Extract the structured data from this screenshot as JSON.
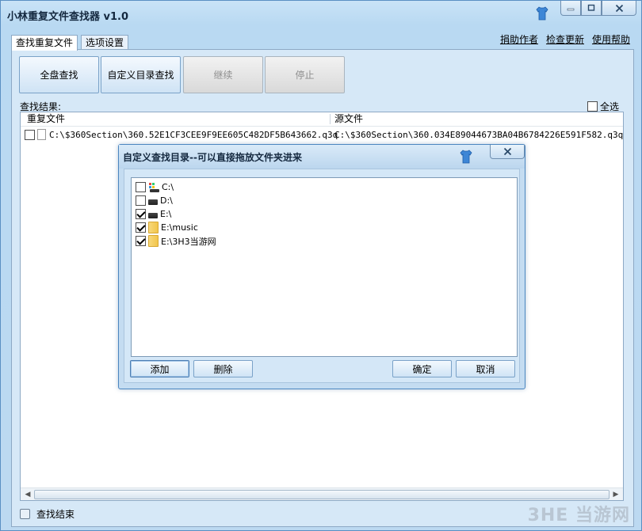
{
  "window": {
    "title": "小林重复文件查找器 v1.0"
  },
  "tabs": [
    {
      "label": "查找重复文件",
      "active": true
    },
    {
      "label": "选项设置",
      "active": false
    }
  ],
  "top_links": [
    "捐助作者",
    "检查更新",
    "使用帮助"
  ],
  "toolbar": {
    "full_scan": "全盘查找",
    "custom_scan": "自定义目录查找",
    "continue": "继续",
    "stop": "停止"
  },
  "results": {
    "label": "查找结果:",
    "select_all": "全选",
    "columns": [
      "重复文件",
      "源文件"
    ],
    "rows": [
      {
        "duplicate": "C:\\$360Section\\360.52E1CF3CEE9F9EE605C482DF5B643662.q3q",
        "source": "C:\\$360Section\\360.034E89044673BA04B6784226E591F582.q3q"
      }
    ]
  },
  "status": {
    "text": "查找结束"
  },
  "watermark": "3HE 当游网",
  "dialog": {
    "title": "自定义查找目录--可以直接拖放文件夹进来",
    "items": [
      {
        "label": "C:\\",
        "checked": false,
        "icon": "system-drive-icon"
      },
      {
        "label": "D:\\",
        "checked": false,
        "icon": "drive-icon"
      },
      {
        "label": "E:\\",
        "checked": true,
        "icon": "drive-icon"
      },
      {
        "label": "E:\\music",
        "checked": true,
        "icon": "folder-icon"
      },
      {
        "label": "E:\\3H3当游网",
        "checked": true,
        "icon": "folder-icon"
      }
    ],
    "buttons": {
      "add": "添加",
      "delete": "删除",
      "ok": "确定",
      "cancel": "取消"
    }
  }
}
